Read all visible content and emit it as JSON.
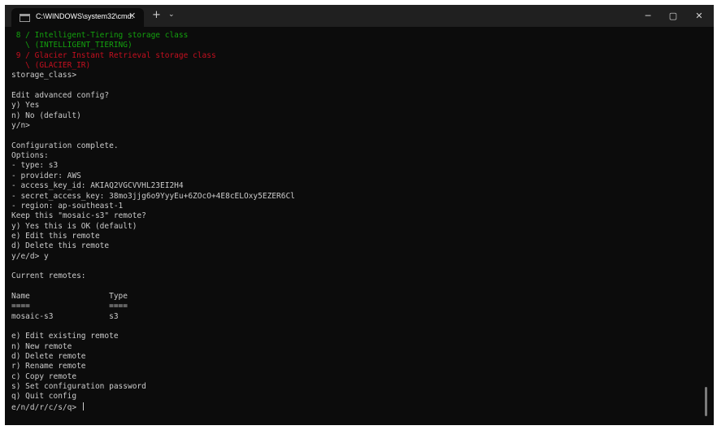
{
  "window": {
    "tab_title": "C:\\WINDOWS\\system32\\cmd.",
    "tab_close_icon": "close-icon",
    "new_tab_glyph": "+",
    "dropdown_glyph": "⌄",
    "minimize_glyph": "─",
    "maximize_glyph": "▢",
    "close_glyph": "✕"
  },
  "colors": {
    "terminal_bg": "#0c0c0c",
    "titlebar_bg": "#202020",
    "default_text": "#cccccc",
    "green_text": "#13a10e",
    "red_text": "#c50f1f"
  },
  "terminal": {
    "lines": [
      {
        "text": " 8 / Intelligent-Tiering storage class",
        "color": "green"
      },
      {
        "text": "   \\ (INTELLIGENT_TIERING)",
        "color": "green"
      },
      {
        "text": " 9 / Glacier Instant Retrieval storage class",
        "color": "red"
      },
      {
        "text": "   \\ (GLACIER_IR)",
        "color": "red"
      },
      {
        "text": "storage_class>",
        "color": "default"
      },
      {
        "text": "",
        "color": "default"
      },
      {
        "text": "Edit advanced config?",
        "color": "default"
      },
      {
        "text": "y) Yes",
        "color": "default"
      },
      {
        "text": "n) No (default)",
        "color": "default"
      },
      {
        "text": "y/n>",
        "color": "default"
      },
      {
        "text": "",
        "color": "default"
      },
      {
        "text": "Configuration complete.",
        "color": "default"
      },
      {
        "text": "Options:",
        "color": "default"
      },
      {
        "text": "- type: s3",
        "color": "default"
      },
      {
        "text": "- provider: AWS",
        "color": "default"
      },
      {
        "text": "- access_key_id: AKIAQ2VGCVVHL23EI2H4",
        "color": "default"
      },
      {
        "text": "- secret_access_key: 38mo3jjg6o9YyyEu+6ZOcO+4E8cELOxy5EZER6Cl",
        "color": "default"
      },
      {
        "text": "- region: ap-southeast-1",
        "color": "default"
      },
      {
        "text": "Keep this \"mosaic-s3\" remote?",
        "color": "default"
      },
      {
        "text": "y) Yes this is OK (default)",
        "color": "default"
      },
      {
        "text": "e) Edit this remote",
        "color": "default"
      },
      {
        "text": "d) Delete this remote",
        "color": "default"
      },
      {
        "text": "y/e/d> y",
        "color": "default"
      },
      {
        "text": "",
        "color": "default"
      },
      {
        "text": "Current remotes:",
        "color": "default"
      },
      {
        "text": "",
        "color": "default"
      },
      {
        "text": "Name                 Type",
        "color": "default"
      },
      {
        "text": "====                 ====",
        "color": "default"
      },
      {
        "text": "mosaic-s3            s3",
        "color": "default"
      },
      {
        "text": "",
        "color": "default"
      },
      {
        "text": "e) Edit existing remote",
        "color": "default"
      },
      {
        "text": "n) New remote",
        "color": "default"
      },
      {
        "text": "d) Delete remote",
        "color": "default"
      },
      {
        "text": "r) Rename remote",
        "color": "default"
      },
      {
        "text": "c) Copy remote",
        "color": "default"
      },
      {
        "text": "s) Set configuration password",
        "color": "default"
      },
      {
        "text": "q) Quit config",
        "color": "default"
      }
    ],
    "prompt": "e/n/d/r/c/s/q> "
  }
}
